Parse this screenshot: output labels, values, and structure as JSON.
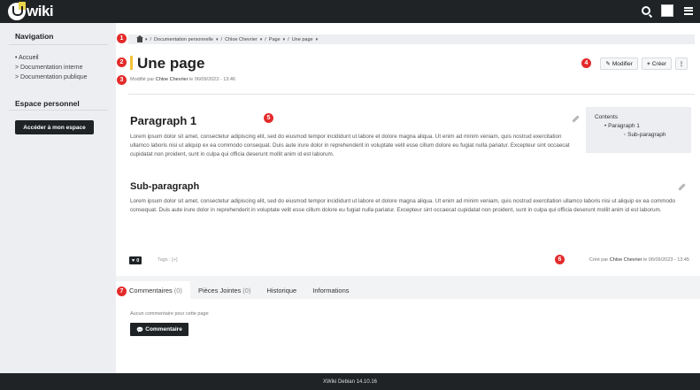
{
  "app": {
    "logo_text": "wiki"
  },
  "sidebar": {
    "nav_title": "Navigation",
    "items": [
      {
        "label": "• Accueil"
      },
      {
        "label": "> Documentation interne"
      },
      {
        "label": "> Documentation publique"
      }
    ],
    "personal_title": "Espace personnel",
    "personal_button": "Accéder à mon espace"
  },
  "breadcrumb": {
    "items": [
      "Documentation personnelle",
      "Chloe Chevrier",
      "Page",
      "Une page"
    ],
    "separator": "/"
  },
  "page": {
    "title": "Une page",
    "modified_prefix": "Modifié par",
    "modified_author": "Chloe Chevrier",
    "modified_suffix": "le 06/09/2023 - 13:46",
    "edit_label": "Modifier",
    "create_label": "Créer",
    "more_label": "⋮"
  },
  "content": {
    "h1": "Paragraph 1",
    "p1": "Lorem ipsum dolor sit amet, consectetur adipiscing elit, sed do eiusmod tempor incididunt ut labore et dolore magna aliqua. Ut enim ad minim veniam, quis nostrud exercitation ullamco laboris nisi ut aliquip ex ea commodo consequat. Duis aute irure dolor in reprehenderit in voluptate velit esse cillum dolore eu fugiat nulla pariatur. Excepteur sint occaecat cupidatat non proident, sunt in culpa qui officia deserunt mollit anim id est laborum.",
    "h2": "Sub-paragraph",
    "p2": "Lorem ipsum dolor sit amet, consectetur adipiscing elit, sed do eiusmod tempor incididunt ut labore et dolore magna aliqua. Ut enim ad minim veniam, quis nostrud exercitation ullamco laboris nisi ut aliquip ex ea commodo consequat. Duis aute irure dolor in reprehenderit in voluptate velit esse cillum dolore eu fugiat nulla pariatur. Excepteur sint occaecat cupidatat non proident, sunt in culpa qui officia deserunt mollit anim id est laborum."
  },
  "toc": {
    "title": "Contents",
    "l1": "• Paragraph 1",
    "l2": "◦ Sub-paragraph"
  },
  "meta": {
    "likes": "0",
    "tags": "Tags : [+]",
    "created_prefix": "Créé par",
    "created_author": "Chloe Chevrier",
    "created_suffix": "le 06/09/2023 - 13:45"
  },
  "tabs": [
    {
      "label": "Commentaires",
      "count": "(0)"
    },
    {
      "label": "Pièces Jointes",
      "count": "(0)"
    },
    {
      "label": "Historique",
      "count": ""
    },
    {
      "label": "Informations",
      "count": ""
    }
  ],
  "comments": {
    "empty_text": "Aucun commentaire pour cette page",
    "button_label": "Commentaire"
  },
  "footer": {
    "text": "XWiki Debian 14.10.16"
  },
  "badges": [
    "1",
    "2",
    "3",
    "4",
    "5",
    "6",
    "7"
  ],
  "colors": {
    "accent_bar": "#f2c23b",
    "badge": "#e42a2a",
    "dark": "#1f2326"
  }
}
